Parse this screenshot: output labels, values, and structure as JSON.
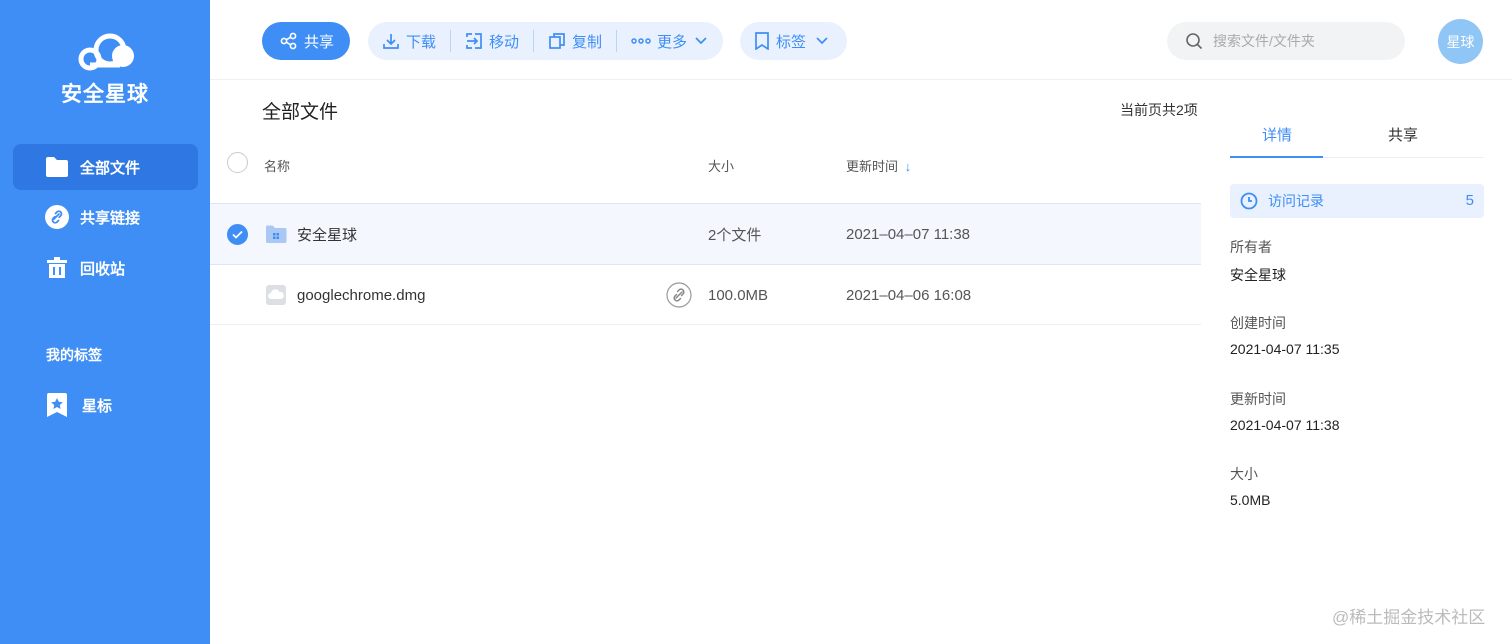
{
  "brand": {
    "name": "安全星球",
    "logo_icon": "cloud-icon"
  },
  "sidebar": {
    "items": [
      {
        "label": "全部文件",
        "icon": "folder-icon",
        "active": true
      },
      {
        "label": "共享链接",
        "icon": "link-icon",
        "active": false
      },
      {
        "label": "回收站",
        "icon": "trash-icon",
        "active": false
      }
    ],
    "tags_section_title": "我的标签",
    "tags": [
      {
        "label": "星标",
        "icon": "star-bookmark-icon"
      }
    ]
  },
  "toolbar": {
    "share_label": "共享",
    "download_label": "下载",
    "move_label": "移动",
    "copy_label": "复制",
    "more_label": "更多",
    "tag_label": "标签"
  },
  "search": {
    "placeholder": "搜索文件/文件夹"
  },
  "user": {
    "avatar_text": "星球"
  },
  "main": {
    "title": "全部文件",
    "count_text": "当前页共2项",
    "columns": {
      "name": "名称",
      "size": "大小",
      "updated": "更新时间"
    },
    "sort_indicator": "↓",
    "files": [
      {
        "name": "安全星球",
        "type": "folder",
        "size": "2个文件",
        "updated": "2021–04–07 11:38",
        "selected": true
      },
      {
        "name": "googlechrome.dmg",
        "type": "file",
        "size": "100.0MB",
        "updated": "2021–04–06 16:08",
        "selected": false,
        "shared": true
      }
    ]
  },
  "detail": {
    "tabs": [
      "详情",
      "共享"
    ],
    "visit_label": "访问记录",
    "visit_count": "5",
    "owner_label": "所有者",
    "owner_value": "安全星球",
    "created_label": "创建时间",
    "created_value": "2021-04-07 11:35",
    "updated_label": "更新时间",
    "updated_value": "2021-04-07 11:38",
    "size_label": "大小",
    "size_value": "5.0MB"
  },
  "watermark": "@稀土掘金技术社区",
  "colors": {
    "accent": "#3f8ef5",
    "sidebar_bg": "#3f8ef5",
    "light_accent": "#e8f1fd"
  }
}
